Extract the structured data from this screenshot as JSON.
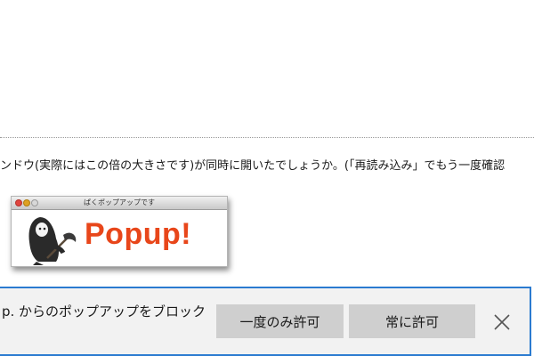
{
  "page": {
    "body_text": "ンドウ(実際にはこの倍の大きさです)が同時に開いたでしょうか。(「再読み込み」でもう一度確認"
  },
  "mock_popup": {
    "window_title": "ぱくポップアップです",
    "logo_text": "Popup!",
    "logo_color": "#e8461a"
  },
  "notification": {
    "message": "p. からのポップアップをブロック",
    "allow_once_label": "一度のみ許可",
    "allow_always_label": "常に許可",
    "close_icon": "close-icon",
    "border_color": "#2b7bd0"
  }
}
